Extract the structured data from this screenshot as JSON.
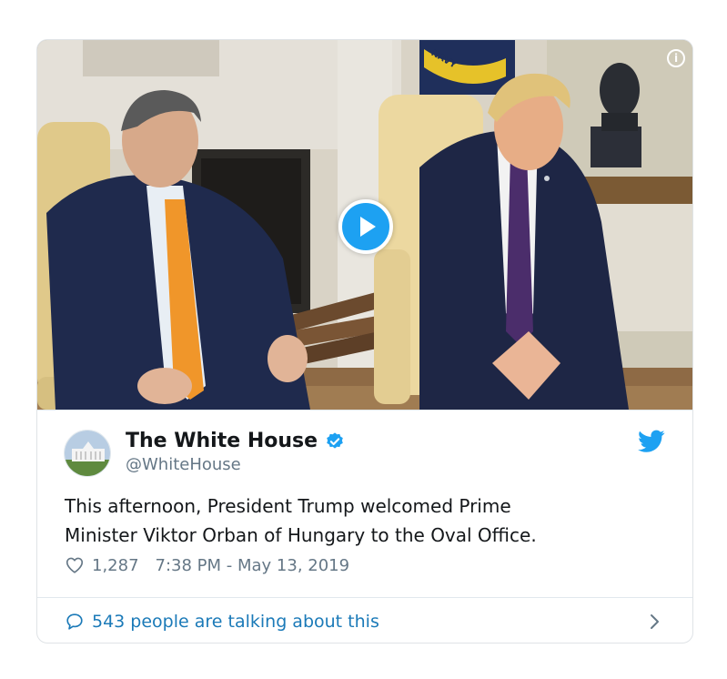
{
  "tweet": {
    "display_name": "The White House",
    "handle": "@WhiteHouse",
    "verified": true,
    "text": "This afternoon, President Trump welcomed Prime\nMinister Viktor Orban of Hungary to the Oval Office.",
    "likes": "1,287",
    "timestamp": "7:38 PM - May 13, 2019",
    "conversation": "543 people are talking about this"
  },
  "media": {
    "type": "video",
    "flag_text": "NAVY"
  },
  "icons": {
    "info": "info-icon",
    "play": "play-icon",
    "verified": "verified-badge-icon",
    "brand": "twitter-bird-icon",
    "like": "heart-icon",
    "reply": "speech-bubble-icon",
    "more": "chevron-right-icon"
  },
  "colors": {
    "accent": "#1da1f2",
    "link": "#1b7ab8",
    "text": "#14171a",
    "muted": "#657786"
  }
}
